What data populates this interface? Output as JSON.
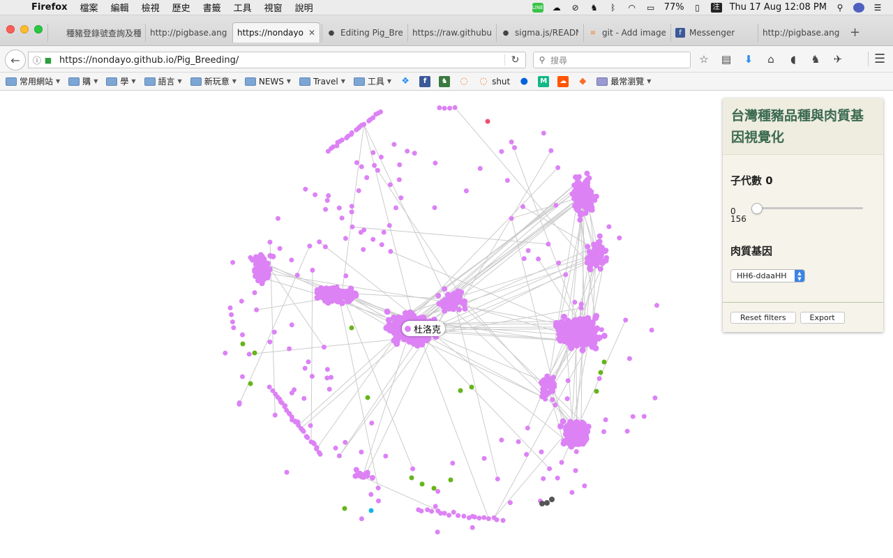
{
  "menubar": {
    "app": "Firefox",
    "items": [
      "檔案",
      "編輯",
      "檢視",
      "歷史",
      "書籤",
      "工具",
      "視窗",
      "說明"
    ],
    "battery": "77%",
    "clock": "Thu 17 Aug  12:08 PM",
    "line_label": "LINE",
    "ime_label": "注"
  },
  "tabs": [
    {
      "label": "種豬登錄號查詢及種豬",
      "active": false,
      "icon": "page-icon"
    },
    {
      "label": "http://pigbase.angrin",
      "active": false,
      "icon": "page-icon"
    },
    {
      "label": "https://nondayo.g",
      "active": true,
      "icon": "page-icon"
    },
    {
      "label": "Editing Pig_Bree",
      "active": false,
      "icon": "github-icon"
    },
    {
      "label": "https://raw.githubus",
      "active": false,
      "icon": "page-icon"
    },
    {
      "label": "sigma.js/READM",
      "active": false,
      "icon": "github-icon"
    },
    {
      "label": "git - Add images",
      "active": false,
      "icon": "stackoverflow-icon"
    },
    {
      "label": "Messenger",
      "active": false,
      "icon": "facebook-icon"
    },
    {
      "label": "http://pigbase.angrin",
      "active": false,
      "icon": "page-icon"
    }
  ],
  "navbar": {
    "url": "https://nondayo.github.io/Pig_Breeding/",
    "search_placeholder": "搜尋"
  },
  "bookmarks": [
    {
      "label": "常用網站",
      "type": "folder"
    },
    {
      "label": "購",
      "type": "folder"
    },
    {
      "label": "學",
      "type": "folder"
    },
    {
      "label": "語言",
      "type": "folder"
    },
    {
      "label": "新玩意",
      "type": "folder"
    },
    {
      "label": "NEWS",
      "type": "folder"
    },
    {
      "label": "Travel",
      "type": "folder"
    },
    {
      "label": "工具",
      "type": "folder"
    },
    {
      "label": "",
      "type": "dropbox"
    },
    {
      "label": "",
      "type": "facebook"
    },
    {
      "label": "",
      "type": "evernote"
    },
    {
      "label": "",
      "type": "loader"
    },
    {
      "label": "shut",
      "type": "loader"
    },
    {
      "label": "",
      "type": "flickr"
    },
    {
      "label": "",
      "type": "medium"
    },
    {
      "label": "",
      "type": "soundcloud"
    },
    {
      "label": "",
      "type": "gitlab"
    },
    {
      "label": "最常瀏覽",
      "type": "folder-special"
    }
  ],
  "panel": {
    "title": "台灣種豬品種與肉質基因視覺化",
    "generation_label": "子代數",
    "generation_value": "0",
    "slider_min": "0",
    "slider_max": "156",
    "slider_fraction": 0,
    "gene_label": "肉質基因",
    "gene_selected": "HH6-ddaaHH",
    "reset_button": "Reset filters",
    "export_button": "Export"
  },
  "graph": {
    "hover_label": "杜洛克",
    "colors": {
      "main": "#dc82f5",
      "green": "#66b51a",
      "red": "#f04e6e",
      "cyan": "#18b4e0",
      "dark": "#555555",
      "edge": "#cccccc"
    }
  }
}
